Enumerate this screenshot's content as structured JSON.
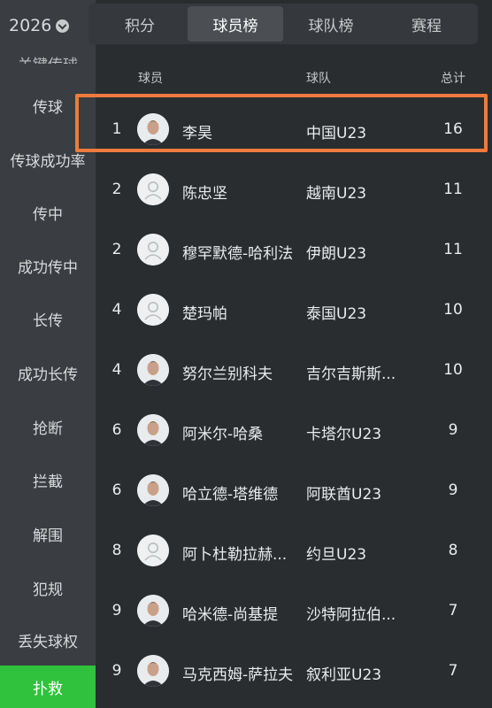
{
  "season": "2026",
  "sidebar": {
    "items": [
      {
        "label": "关键传球"
      },
      {
        "label": "传球"
      },
      {
        "label": "传球成功率"
      },
      {
        "label": "传中"
      },
      {
        "label": "成功传中"
      },
      {
        "label": "长传"
      },
      {
        "label": "成功长传"
      },
      {
        "label": "抢断"
      },
      {
        "label": "拦截"
      },
      {
        "label": "解围"
      },
      {
        "label": "犯规"
      },
      {
        "label": "丢失球权"
      },
      {
        "label": "扑救"
      }
    ]
  },
  "tabs": [
    {
      "label": "积分"
    },
    {
      "label": "球员榜"
    },
    {
      "label": "球队榜"
    },
    {
      "label": "赛程"
    }
  ],
  "table": {
    "headers": {
      "player": "球员",
      "team": "球队",
      "total": "总计"
    },
    "rows": [
      {
        "rank": "1",
        "name": "李昊",
        "team": "中国U23",
        "total": "16",
        "avatar": "photo"
      },
      {
        "rank": "2",
        "name": "陈忠坚",
        "team": "越南U23",
        "total": "11",
        "avatar": "placeholder"
      },
      {
        "rank": "2",
        "name": "穆罕默德-哈利法",
        "team": "伊朗U23",
        "total": "11",
        "avatar": "placeholder"
      },
      {
        "rank": "4",
        "name": "楚玛帕",
        "team": "泰国U23",
        "total": "10",
        "avatar": "placeholder"
      },
      {
        "rank": "4",
        "name": "努尔兰别科夫",
        "team": "吉尔吉斯斯...",
        "total": "10",
        "avatar": "photo"
      },
      {
        "rank": "6",
        "name": "阿米尔-哈桑",
        "team": "卡塔尔U23",
        "total": "9",
        "avatar": "photo"
      },
      {
        "rank": "6",
        "name": "哈立德-塔维德",
        "team": "阿联酋U23",
        "total": "9",
        "avatar": "photo"
      },
      {
        "rank": "8",
        "name": "阿卜杜勒拉赫...",
        "team": "约旦U23",
        "total": "8",
        "avatar": "placeholder"
      },
      {
        "rank": "9",
        "name": "哈米德-尚基提",
        "team": "沙特阿拉伯...",
        "total": "7",
        "avatar": "photo"
      },
      {
        "rank": "9",
        "name": "马克西姆-萨拉夫",
        "team": "叙利亚U23",
        "total": "7",
        "avatar": "photo"
      }
    ]
  },
  "colors": {
    "active_sidebar": "#30c23c",
    "highlight_border": "#f07a3e"
  }
}
